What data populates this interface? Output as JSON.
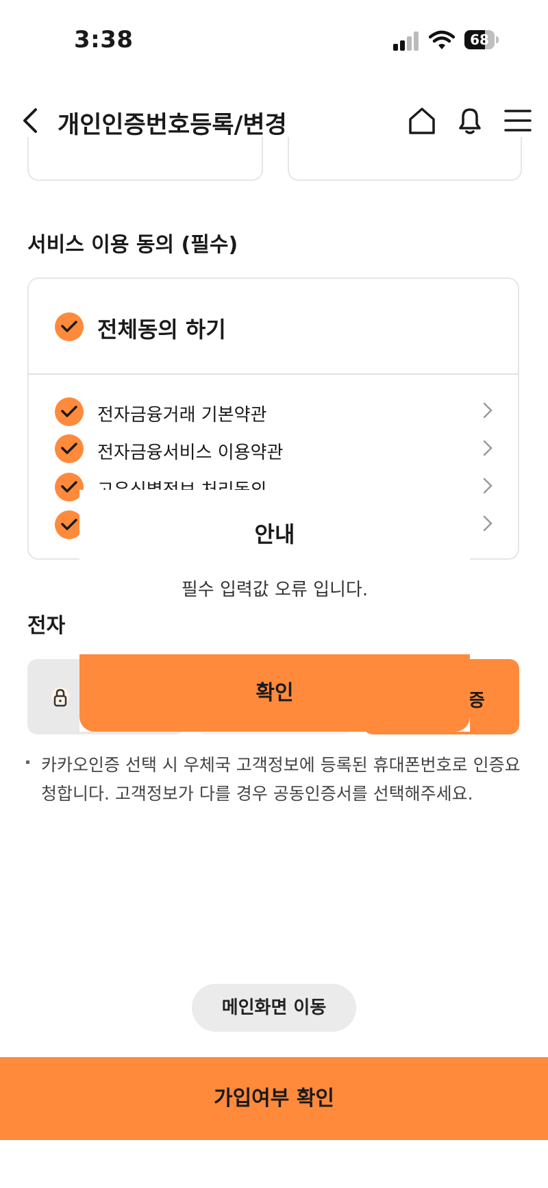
{
  "status_bar": {
    "time": "3:38",
    "battery": "68"
  },
  "header": {
    "title": "개인인증번호등록/변경"
  },
  "agreement": {
    "section_title": "서비스 이용 동의 (필수)",
    "all_label": "전체동의 하기",
    "items": [
      {
        "label": "전자금융거래 기본약관"
      },
      {
        "label": "전자금융서비스 이용약관"
      },
      {
        "label": "고유식별정보 처리동의"
      }
    ]
  },
  "auth": {
    "section_title_partial": "전자",
    "auth_button_partial": "인증"
  },
  "note": "카카오인증 선택 시 우체국 고객정보에 등록된 휴대폰번호로 인증요청합니다. 고객정보가 다를 경우 공동인증서를 선택해주세요.",
  "main_button": "메인화면 이동",
  "join_button": "가입여부 확인",
  "modal": {
    "title": "안내",
    "message": "필수 입력값 오류 입니다.",
    "confirm": "확인"
  },
  "colors": {
    "accent": "#ff8a3c",
    "border": "#e6e6e6"
  },
  "icons": [
    "back-arrow-icon",
    "home-icon",
    "bell-icon",
    "menu-icon",
    "check-icon",
    "chevron-right-icon",
    "lock-icon"
  ]
}
